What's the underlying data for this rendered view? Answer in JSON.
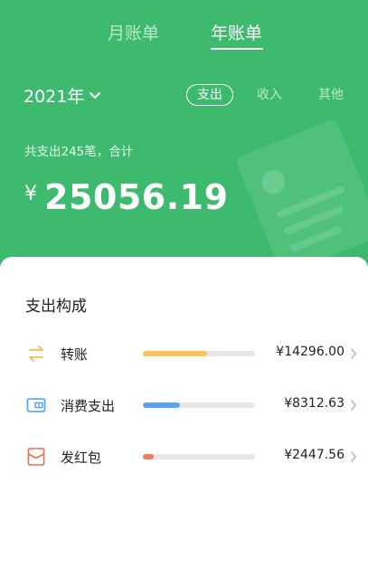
{
  "tabs": {
    "month": "月账单",
    "year": "年账单"
  },
  "year_select": {
    "label": "2021年"
  },
  "filters": {
    "pay": "支出",
    "income": "收入",
    "other": "其他"
  },
  "summary": {
    "text": "共支出245笔，合计",
    "currency": "¥",
    "amount": "25056.19"
  },
  "breakdown": {
    "title": "支出构成",
    "items": [
      {
        "label": "转账",
        "amount": "¥14296.00",
        "share": 0.57,
        "color": "#f9c15a",
        "icon": "transfer-icon"
      },
      {
        "label": "消费支出",
        "amount": "¥8312.63",
        "share": 0.33,
        "color": "#5aa3f4",
        "icon": "wallet-icon"
      },
      {
        "label": "发红包",
        "amount": "¥2447.56",
        "share": 0.1,
        "color": "#f57a5e",
        "icon": "red-envelope-icon"
      }
    ]
  },
  "colors": {
    "header_green": "#3dba6e"
  }
}
